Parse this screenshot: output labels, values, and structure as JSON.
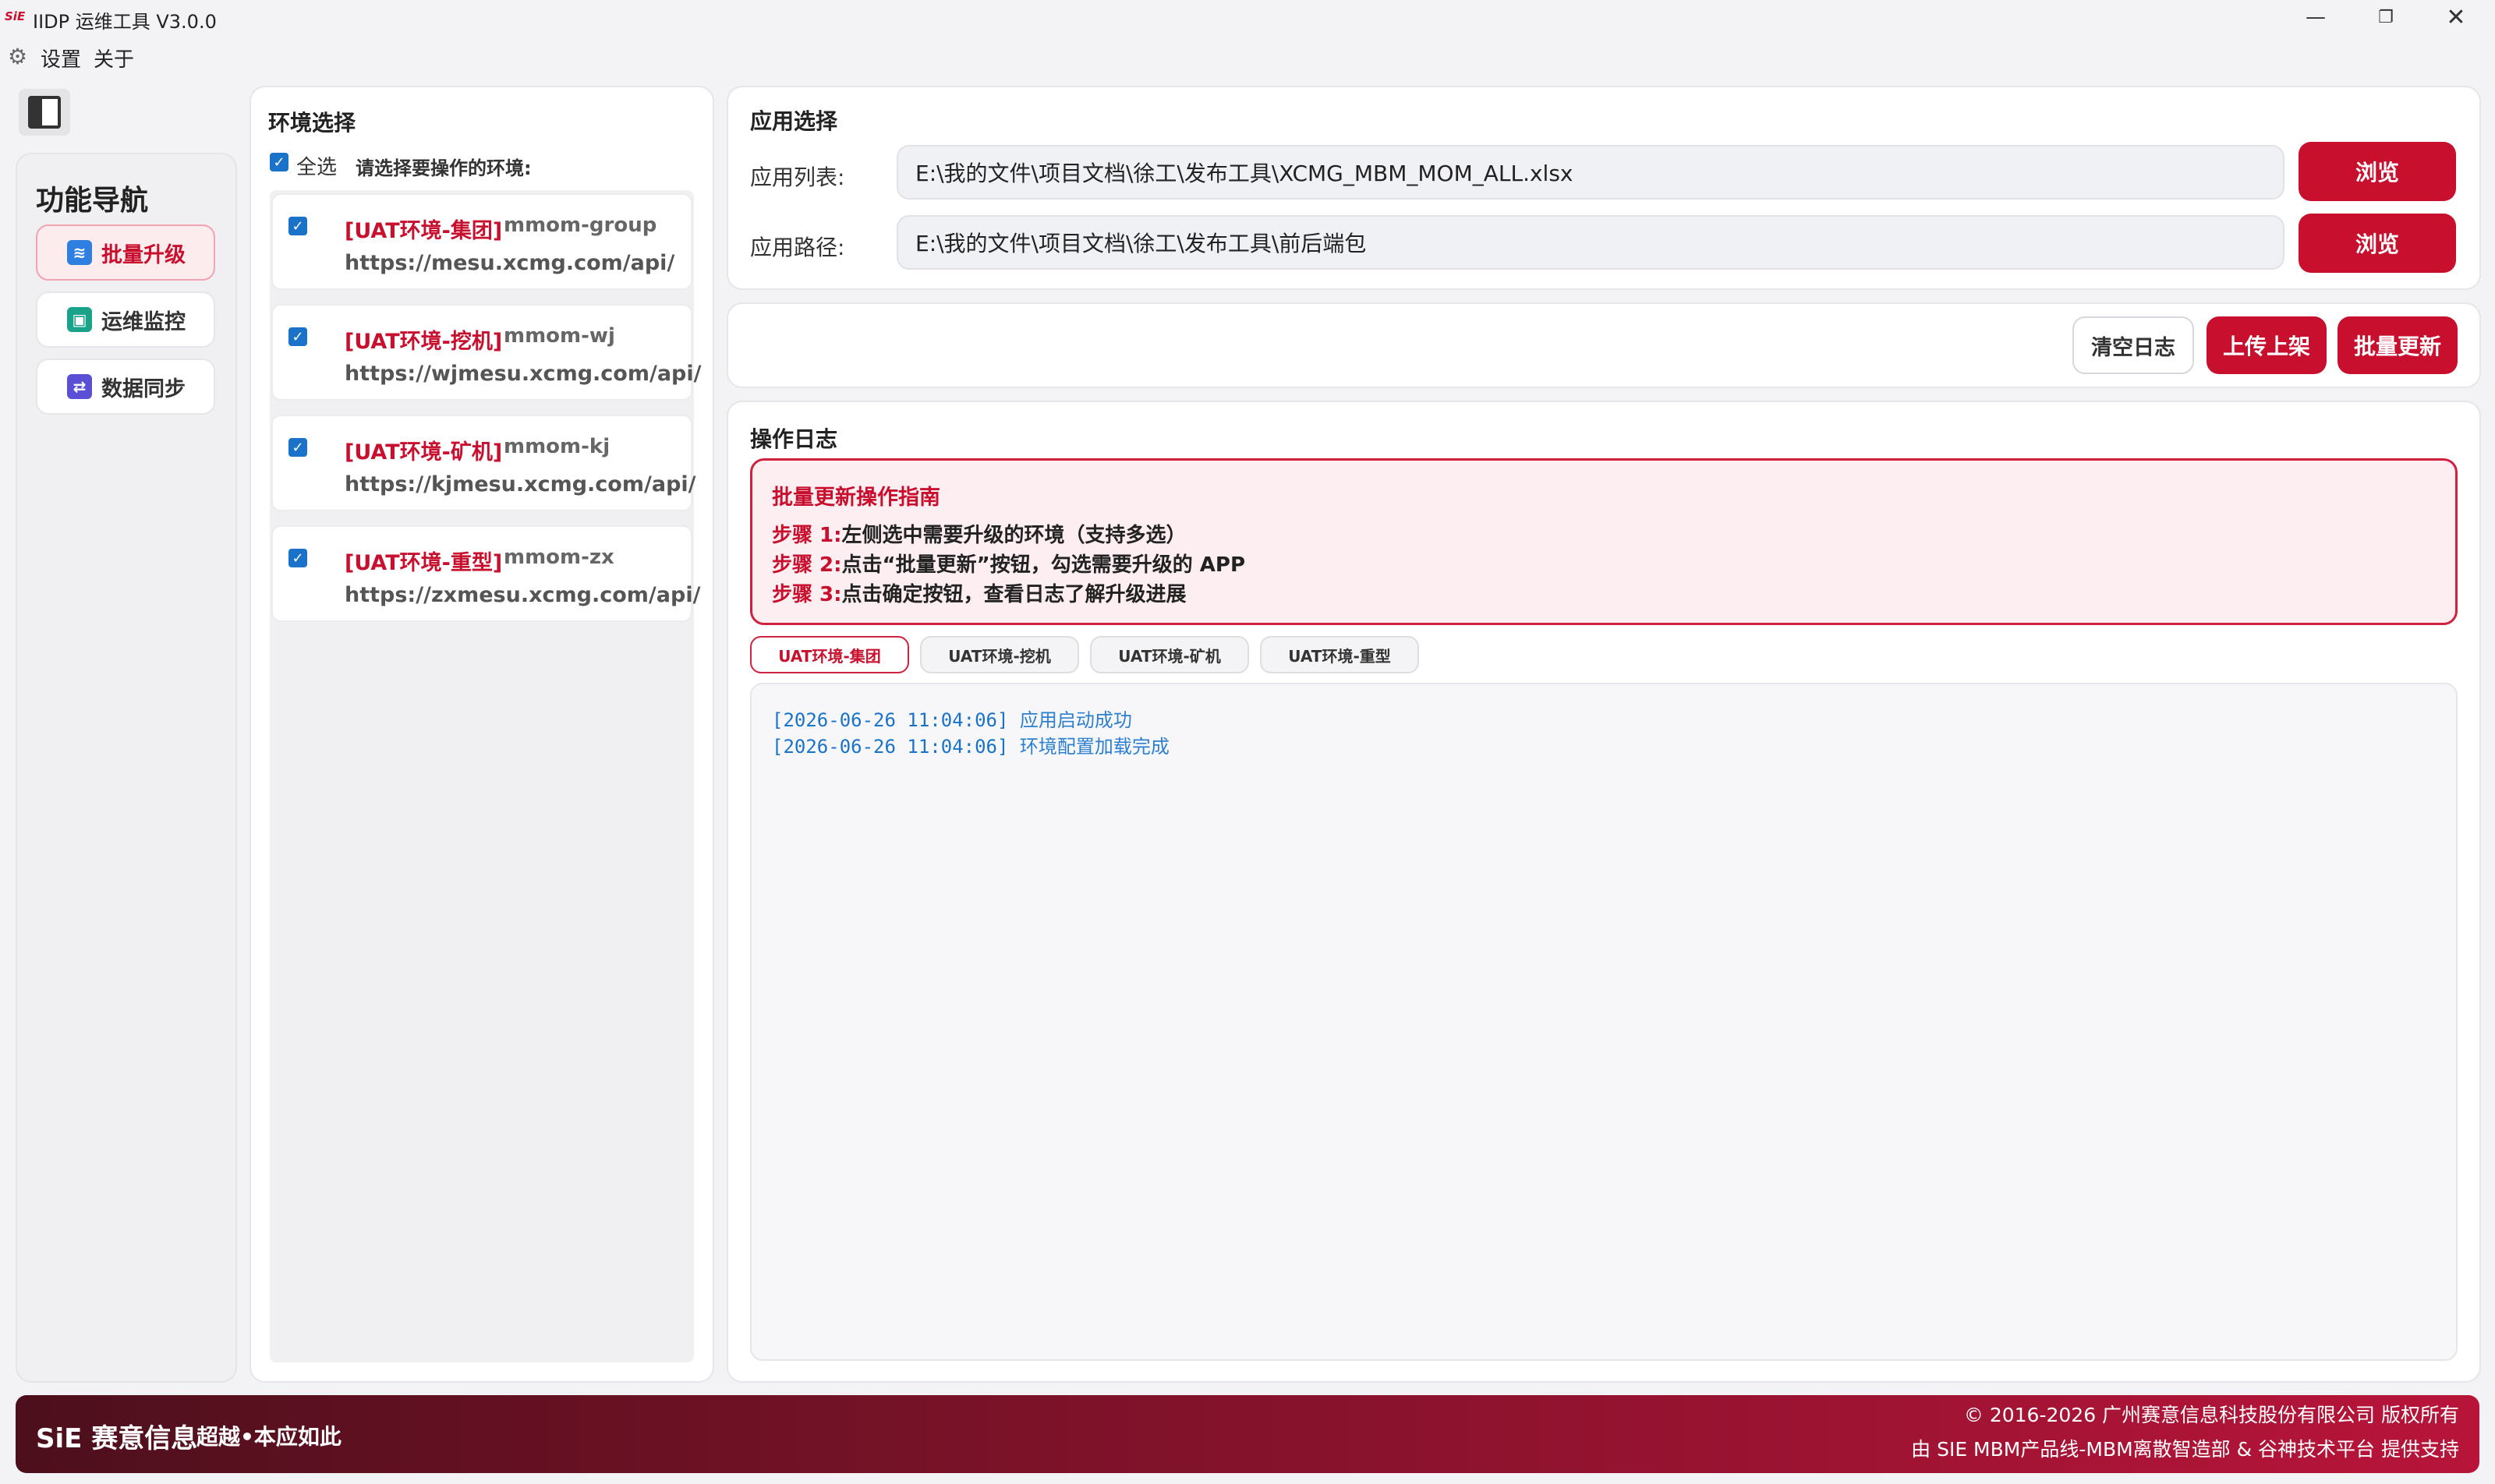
{
  "window": {
    "logo": "SiE",
    "title": "IIDP 运维工具 V3.0.0",
    "minimize": "—",
    "maximize": "❐",
    "close": "✕"
  },
  "menu": {
    "settings": "设置",
    "about": "关于"
  },
  "nav": {
    "title": "功能导航",
    "items": [
      {
        "label": "批量升级",
        "icon": "layers-icon",
        "color": "#2f7fe0",
        "active": true
      },
      {
        "label": "运维监控",
        "icon": "monitor-icon",
        "color": "#1aa38a",
        "active": false
      },
      {
        "label": "数据同步",
        "icon": "sync-icon",
        "color": "#5b4fd6",
        "active": false
      }
    ]
  },
  "env": {
    "title": "环境选择",
    "select_all": "全选",
    "hint": "请选择要操作的环境:",
    "items": [
      {
        "tag": "[UAT环境-集团]",
        "code": "mmom-group",
        "url": "https://mesu.xcmg.com/api/"
      },
      {
        "tag": "[UAT环境-挖机]",
        "code": "mmom-wj",
        "url": "https://wjmesu.xcmg.com/api/"
      },
      {
        "tag": "[UAT环境-矿机]",
        "code": "mmom-kj",
        "url": "https://kjmesu.xcmg.com/api/"
      },
      {
        "tag": "[UAT环境-重型]",
        "code": "mmom-zx",
        "url": "https://zxmesu.xcmg.com/api/"
      }
    ]
  },
  "app": {
    "title": "应用选择",
    "list_label": "应用列表:",
    "list_value": "E:\\我的文件\\项目文档\\徐工\\发布工具\\XCMG_MBM_MOM_ALL.xlsx",
    "path_label": "应用路径:",
    "path_value": "E:\\我的文件\\项目文档\\徐工\\发布工具\\前后端包",
    "browse": "浏览"
  },
  "actions": {
    "clear": "清空日志",
    "upload": "上传上架",
    "batch": "批量更新"
  },
  "log": {
    "title": "操作日志",
    "guide_title": "批量更新操作指南",
    "steps": [
      {
        "label": "步骤 1:",
        "text": "左侧选中需要升级的环境（支持多选）"
      },
      {
        "label": "步骤 2:",
        "text": "点击“批量更新”按钮，勾选需要升级的 APP"
      },
      {
        "label": "步骤 3:",
        "text": "点击确定按钮，查看日志了解升级进展"
      }
    ],
    "tabs": [
      "UAT环境-集团",
      "UAT环境-挖机",
      "UAT环境-矿机",
      "UAT环境-重型"
    ],
    "lines": [
      {
        "time": "[2026-06-26 11:04:06]",
        "msg": "应用启动成功"
      },
      {
        "time": "[2026-06-26 11:04:06]",
        "msg": "环境配置加载完成"
      }
    ]
  },
  "footer": {
    "logo": "SiE 赛意信息",
    "slogan": "超越•本应如此",
    "copyright": "© 2016-2026 广州赛意信息科技股份有限公司 版权所有",
    "support": "由 SIE MBM产品线-MBM离散智造部 & 谷神技术平台 提供支持"
  },
  "colors": {
    "brand": "#c8102e",
    "link_blue": "#1a73c8"
  }
}
